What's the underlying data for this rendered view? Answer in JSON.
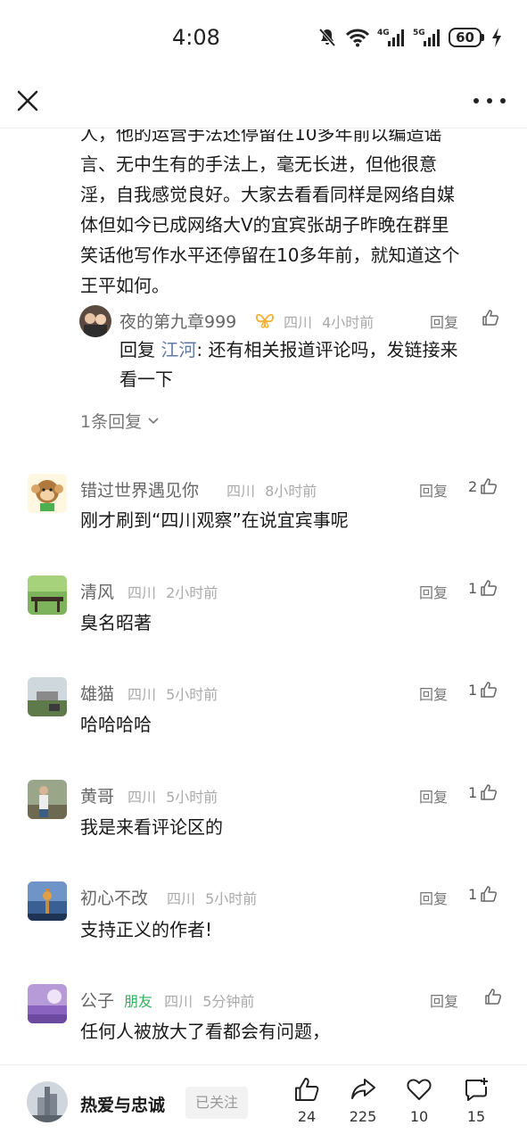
{
  "status_bar": {
    "time": "4:08",
    "net_4g": "4G",
    "net_5g": "5G",
    "battery": "60"
  },
  "article_excerpt": [
    "人，他的运营手法还停留在10多年前以编造谣",
    "言、无中生有的手法上，毫无长进，但他很意",
    "淫，自我感觉良好。大家去看看同样是网络自媒",
    "体但如今已成网络大V的宜宾张胡子昨晚在群里",
    "笑话他写作水平还停留在10多年前，就知道这个",
    "王平如何。"
  ],
  "nested_reply": {
    "name": "夜的第九章999",
    "region": "四川",
    "time": "4小时前",
    "reply_label": "回复",
    "reply_prefix": "回复 ",
    "mention": "江河",
    "text_line1": ": 还有相关报道评论吗，发链接来",
    "text_line2": "看一下"
  },
  "more_replies_label": "1条回复",
  "comments": [
    {
      "name": "错过世界遇见你",
      "region": "四川",
      "time": "8小时前",
      "reply_label": "回复",
      "likes": "2",
      "text": "刚才刷到“四川观察”在说宜宾事呢"
    },
    {
      "name": "清风",
      "region": "四川",
      "time": "2小时前",
      "reply_label": "回复",
      "likes": "1",
      "text": "臭名昭著"
    },
    {
      "name": "雄猫",
      "region": "四川",
      "time": "5小时前",
      "reply_label": "回复",
      "likes": "1",
      "text": "哈哈哈哈"
    },
    {
      "name": "黄哥",
      "region": "四川",
      "time": "5小时前",
      "reply_label": "回复",
      "likes": "1",
      "text": "我是来看评论区的"
    },
    {
      "name": "初心不改",
      "region": "四川",
      "time": "5小时前",
      "reply_label": "回复",
      "likes": "1",
      "text": "支持正义的作者!"
    },
    {
      "name": "公子",
      "tag": "朋友",
      "region": "四川",
      "time": "5分钟前",
      "reply_label": "回复",
      "likes": "",
      "text": "任何人被放大了看都会有问题，"
    }
  ],
  "bottom_bar": {
    "author_name": "热爱与忠诚",
    "follow_label": "已关注",
    "likes_count": "24",
    "shares_count": "225",
    "favorites_count": "10",
    "comments_count": "15"
  },
  "colors": {
    "mention": "#6279a5",
    "friend_tag": "#2fb15e",
    "meta_gray": "#aaaaaa",
    "vip_badge": "#f2b233"
  }
}
